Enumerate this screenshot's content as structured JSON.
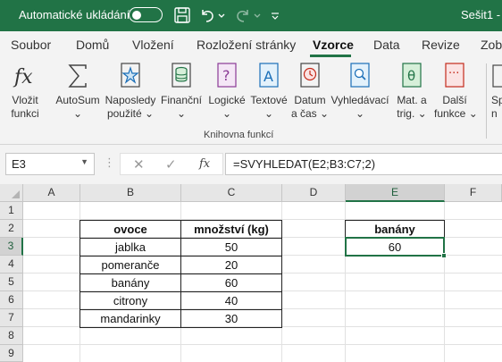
{
  "titlebar": {
    "autosave_label": "Automatické ukládání",
    "filename": "Sešit1  -",
    "icons": [
      "toggle-off-icon",
      "save-icon",
      "undo-icon",
      "chevron-down-icon",
      "redo-icon",
      "customize-quick-access-icon"
    ]
  },
  "ribbon_tabs": [
    {
      "label": "Soubor",
      "active": false
    },
    {
      "label": "Domů",
      "active": false
    },
    {
      "label": "Vložení",
      "active": false
    },
    {
      "label": "Rozložení stránky",
      "active": false
    },
    {
      "label": "Vzorce",
      "active": true
    },
    {
      "label": "Data",
      "active": false
    },
    {
      "label": "Revize",
      "active": false
    },
    {
      "label": "Zob",
      "active": false
    }
  ],
  "ribbon": {
    "group_label": "Knihovna funkcí",
    "buttons": [
      {
        "line1": "Vložit",
        "line2": "funkci",
        "icon": "fx-icon"
      },
      {
        "line1": "AutoSum",
        "line2": "",
        "icon": "sigma-icon"
      },
      {
        "line1": "Naposledy",
        "line2": "použité",
        "icon": "star-icon"
      },
      {
        "line1": "Finanční",
        "line2": "",
        "icon": "coins-icon"
      },
      {
        "line1": "Logické",
        "line2": "",
        "icon": "question-book-icon"
      },
      {
        "line1": "Textové",
        "line2": "",
        "icon": "text-book-icon"
      },
      {
        "line1": "Datum",
        "line2": "a čas",
        "icon": "clock-book-icon"
      },
      {
        "line1": "Vyhledávací",
        "line2": "",
        "icon": "search-book-icon"
      },
      {
        "line1": "Mat. a",
        "line2": "trig.",
        "icon": "theta-book-icon"
      },
      {
        "line1": "Další",
        "line2": "funkce",
        "icon": "more-book-icon"
      },
      {
        "line1": "Sp",
        "line2": "n",
        "icon": "name-manager-icon"
      }
    ],
    "accent": "#217346"
  },
  "formula_bar": {
    "name_box": "E3",
    "fx_label": "fx",
    "formula": "=SVYHLEDAT(E2;B3:C7;2)"
  },
  "sheet": {
    "columns": [
      "A",
      "B",
      "C",
      "D",
      "E",
      "F"
    ],
    "rows": [
      "1",
      "2",
      "3",
      "4",
      "5",
      "6",
      "7",
      "8",
      "9"
    ],
    "selected_cell": "E3",
    "table": {
      "header": {
        "fruit": "ovoce",
        "qty": "množství (kg)"
      },
      "rows": [
        {
          "fruit": "jablka",
          "qty": "50"
        },
        {
          "fruit": "pomeranče",
          "qty": "20"
        },
        {
          "fruit": "banány",
          "qty": "60"
        },
        {
          "fruit": "citrony",
          "qty": "40"
        },
        {
          "fruit": "mandarinky",
          "qty": "30"
        }
      ]
    },
    "lookup": {
      "key": "banány",
      "result": "60"
    }
  }
}
